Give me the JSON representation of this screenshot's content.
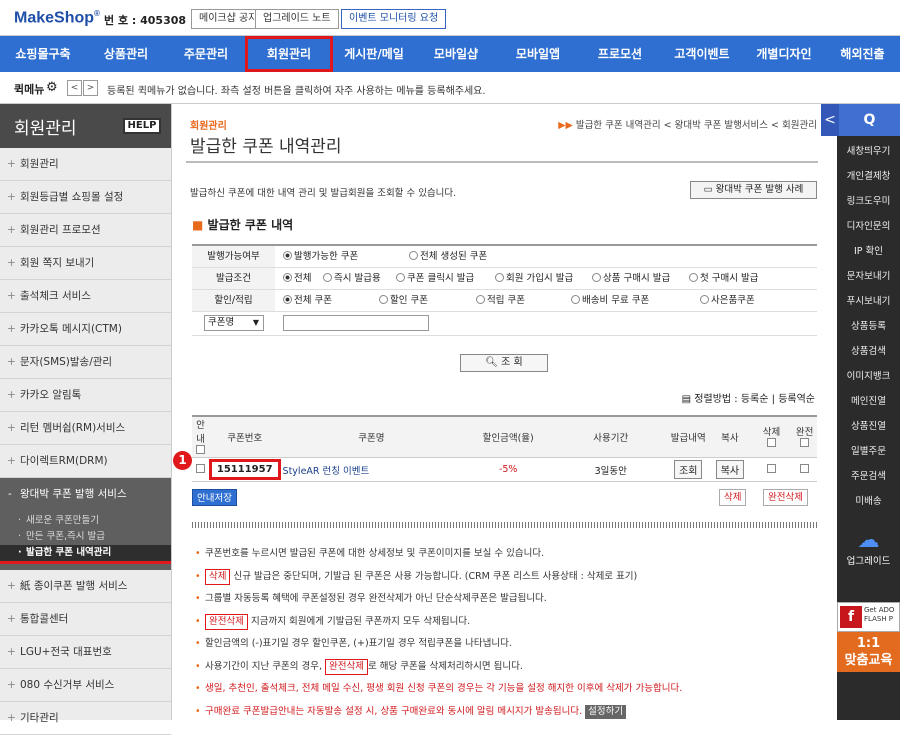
{
  "header": {
    "logo": "MakeShop",
    "logo_mark": "®",
    "bizno": "번 호 : 405308",
    "buttons": [
      "메이크샵 공지",
      "업그레이드 노트",
      "이벤트 모니터링 요청"
    ]
  },
  "gnb": [
    "쇼핑몰구축",
    "상품관리",
    "주문관리",
    "회원관리",
    "게시판/메일",
    "모바일샵",
    "모바일앱",
    "프로모션",
    "고객이벤트",
    "개별디자인",
    "해외진출"
  ],
  "quick": {
    "label": "퀵메뉴",
    "prev": "<",
    "next": ">",
    "message": "등록된 퀵메뉴가 없습니다. 좌측 설정 버튼을 클릭하여 자주 사용하는 메뉴를 등록해주세요."
  },
  "lnb": {
    "title": "회원관리",
    "help": "HELP",
    "items_top": [
      "회원관리",
      "회원등급별 쇼핑몰 설정",
      "회원관리 프로모션",
      "회원 쪽지 보내기",
      "출석체크 서비스",
      "카카오톡 메시지(CTM)",
      "문자(SMS)발송/관리",
      "카카오 알림톡",
      "리턴 멤버쉽(RM)서비스",
      "다이렉트RM(DRM)"
    ],
    "open_group": "왕대박 쿠폰 발행 서비스",
    "sub_items": [
      "새로운 쿠폰만들기",
      "만든 쿠폰,즉시 발급",
      "발급한 쿠폰 내역관리"
    ],
    "items_bottom": [
      "紙 종이쿠폰 발행 서비스",
      "통합콜센터",
      "LGU+전국 대표번호",
      "080 수신거부 서비스",
      "기타관리"
    ]
  },
  "page": {
    "crumb_small": "회원관리",
    "title": "발급한 쿠폰 내역관리",
    "breadcrumb": "발급한 쿠폰 내역관리 < 왕대박 쿠폰 발행서비스 < 회원관리",
    "breadcrumb_mark": "▶▶",
    "description": "발급하신 쿠폰에 대한 내역 관리 및 발급회원을 조회할 수 있습니다.",
    "sample_button": "왕대박 쿠폰 발행 사례",
    "section_title": "발급한 쿠폰 내역",
    "section_dot": "■"
  },
  "filter": {
    "row1": {
      "label": "발행가능여부",
      "options": [
        "발행가능한 쿠폰",
        "전체 생성된 쿠폰"
      ]
    },
    "row2": {
      "label": "발급조건",
      "options": [
        "전체",
        "즉시 발급용",
        "쿠폰 클릭시 발급",
        "회원 가입시 발급",
        "상품 구매시 발급",
        "첫 구매시 발급"
      ]
    },
    "row3": {
      "label": "할인/적립",
      "options": [
        "전체 쿠폰",
        "할인 쿠폰",
        "적립 쿠폰",
        "배송비 무료 쿠폰",
        "사은품쿠폰"
      ]
    },
    "select_value": "쿠폰명",
    "search_button": "조 회",
    "search_icon": "magnifier-icon"
  },
  "sort": {
    "label": "정렬방법 : 등록순",
    "alt": "등록역순",
    "sep": "|"
  },
  "table": {
    "headers": [
      "안내",
      "쿠폰번호",
      "쿠폰명",
      "할인금액(율)",
      "사용기간",
      "발급내역",
      "복사",
      "삭제",
      "완전"
    ],
    "row": {
      "coupon_no": "15111957",
      "name": "StyleAR 런칭 이벤트",
      "discount": "-5%",
      "period": "3일동안",
      "view_btn": "조회",
      "copy_btn": "복사"
    },
    "marker": "1"
  },
  "actions": {
    "guide": "안내저장",
    "delete": "삭제",
    "full_delete": "완전삭제"
  },
  "notes": {
    "n1": "쿠폰번호를 누르시면 발급된 쿠폰에 대한 상세정보 및 쿠폰이미지를 보실 수 있습니다.",
    "n2_tag": "삭제",
    "n2": "신규 발급은 중단되며, 기발급 된 쿠폰은 사용 가능합니다. (CRM 쿠폰 리스트 사용상태 : 삭제로 표기)",
    "n3": "그룹별 자동등록 혜택에 쿠폰설정된 경우 완전삭제가 아닌 단순삭제쿠폰은 발급됩니다.",
    "n4_tag": "완전삭제",
    "n4": "지금까지 회원에게 기발급된 쿠폰까지 모두 삭제됩니다.",
    "n5": "할인금액의 (-)표기일 경우 할인쿠폰, (+)표기일 경우 적립쿠폰을 나타냅니다.",
    "n6a": "사용기간이 지난 쿠폰의 경우,",
    "n6_tag": "완전삭제",
    "n6b": "로 해당 쿠폰을 삭제처리하시면 됩니다.",
    "n7": "생일, 추천인, 출석체크, 전체 메일 수신, 평생 회원 신청 쿠폰의 경우는 각 기능을 설정 해지한 이후에 삭제가 가능합니다.",
    "n8": "구매완료 쿠폰발급안내는 자동발송 설정 시, 상품 구매완료와 동시에 알림 메시지가 발송됩니다.",
    "n8_tag": "설정하기"
  },
  "rside": {
    "toggle": "<",
    "search": "Q",
    "items": [
      "새창띄우기",
      "개인결제창",
      "링크도우미",
      "디자인문의",
      "IP 확인",
      "문자보내기",
      "푸시보내기",
      "상품등록",
      "상품검색",
      "이미지뱅크",
      "메인진열",
      "상품진열",
      "일별주문",
      "주문검색",
      "미배송"
    ],
    "upload": "업그레이드",
    "flash_text": "Get ADO\nFLASH P",
    "flash_icon": "f",
    "edu": "1:1\n맞춤교육"
  },
  "colors": {
    "gnb": "#2e6fd1",
    "accent": "#e86a1c",
    "highlight": "#e0181c"
  }
}
